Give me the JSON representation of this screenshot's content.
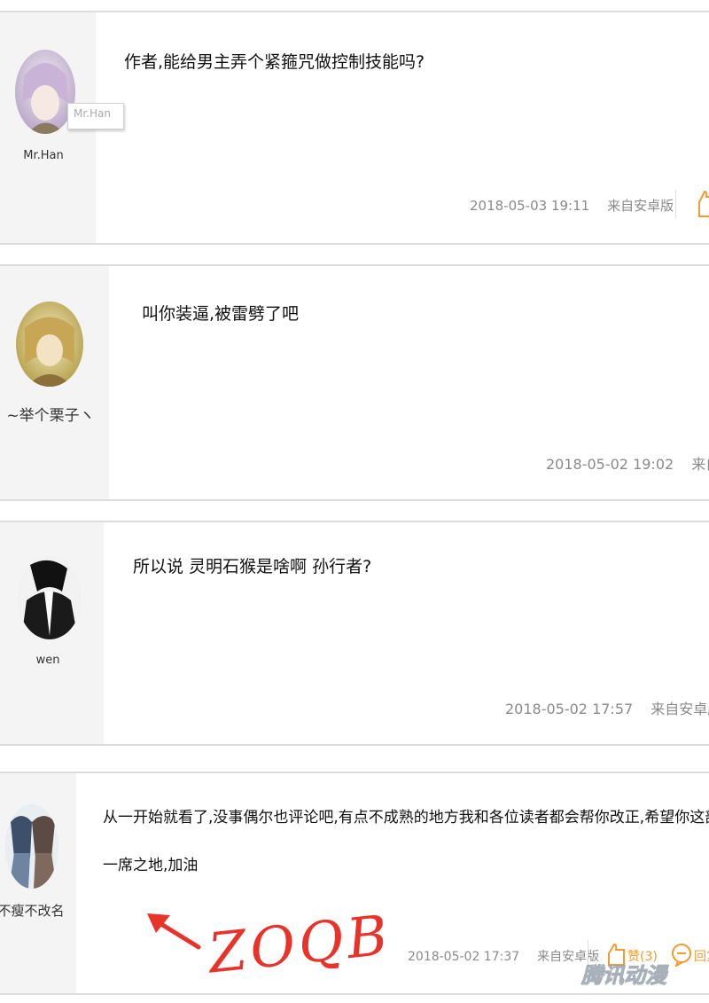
{
  "colors": {
    "accent_orange": "#f29b33",
    "annotation_red": "#e8332a",
    "meta_gray": "#8a8a8a"
  },
  "comments": [
    {
      "username": "Mr.Han",
      "tooltip": "Mr.Han",
      "text": "作者,能给男主弄个紧箍咒做控制技能吗?",
      "date": "2018-05-03 19:11",
      "source": "来自安卓版"
    },
    {
      "username": "~举个栗子ヽ",
      "text": "叫你装逼,被雷劈了吧",
      "date": "2018-05-02 19:02",
      "source": "来自"
    },
    {
      "username": "wen",
      "text": "所以说 灵明石猴是啥啊 孙行者?",
      "date": "2018-05-02 17:57",
      "source": "来自安卓版"
    },
    {
      "username": "不瘦不改名",
      "text_line1": "从一开始就看了,没事偶尔也评论吧,有点不成熟的地方我和各位读者都会帮你改正,希望你这部漫画能有",
      "text_line2": "一席之地,加油",
      "date": "2018-05-02 17:37",
      "source": "来自安卓版",
      "like_label": "赞(3)",
      "reply_label": "回复"
    }
  ],
  "annotation": {
    "handwriting": "ZOQB"
  },
  "watermark": "腾讯动漫",
  "icons": [
    "thumb-up-icon",
    "reply-bubble-icon",
    "arrow-annotation-icon"
  ]
}
